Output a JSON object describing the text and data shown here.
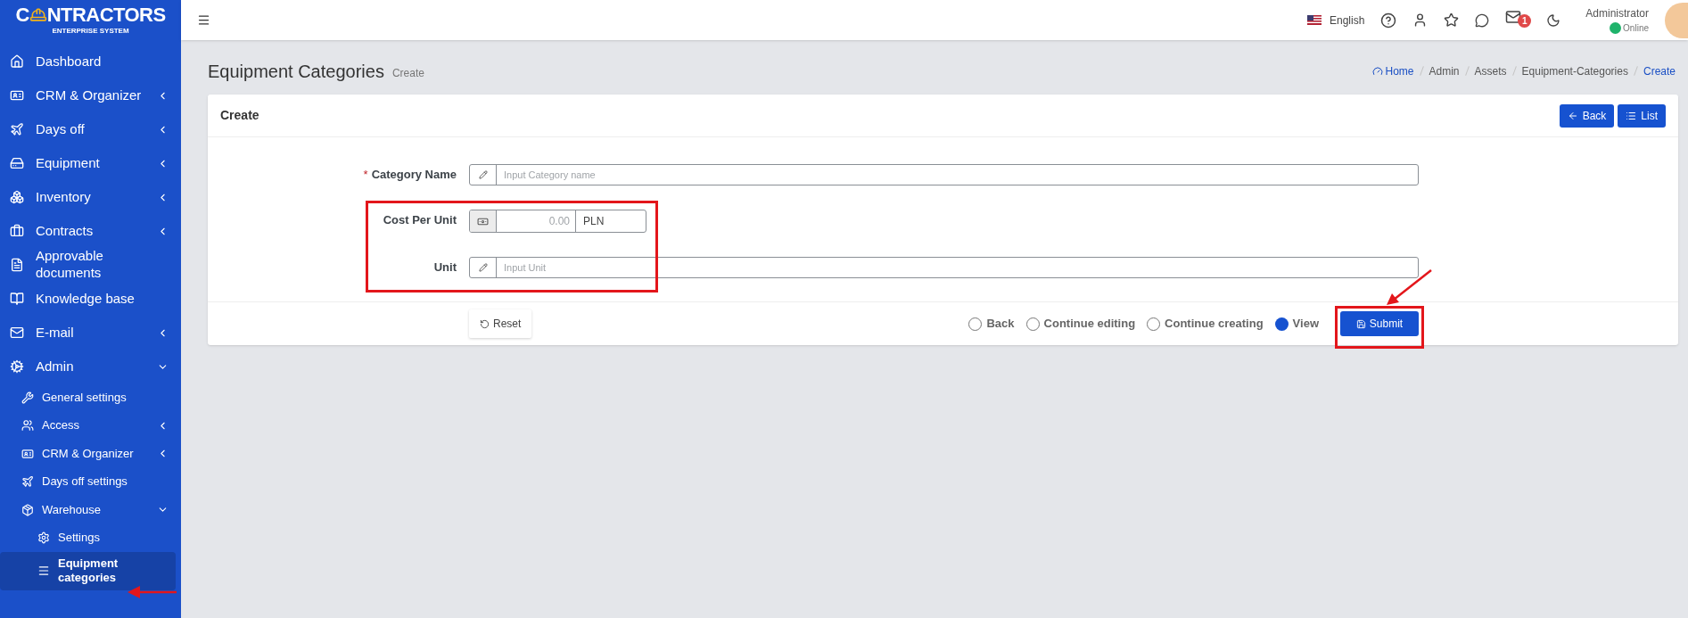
{
  "logo": {
    "text_before": "C",
    "text_after": "NTRACTORS",
    "subtitle": "ENTERPRISE SYSTEM"
  },
  "sidebar": {
    "items": [
      {
        "label": "Dashboard",
        "selected": false
      },
      {
        "label": "CRM & Organizer",
        "selected": false,
        "expanded": false
      },
      {
        "label": "Days off",
        "selected": false,
        "expanded": false
      },
      {
        "label": "Equipment",
        "selected": false,
        "expanded": false
      },
      {
        "label": "Inventory",
        "selected": false,
        "expanded": false
      },
      {
        "label": "Contracts",
        "selected": false,
        "expanded": false
      },
      {
        "label": "Approvable documents",
        "selected": false
      },
      {
        "label": "Knowledge base",
        "selected": false
      },
      {
        "label": "E-mail",
        "selected": false,
        "expanded": false
      },
      {
        "label": "Admin",
        "selected": false,
        "expanded": true,
        "children": [
          {
            "label": "General settings",
            "selected": false
          },
          {
            "label": "Access",
            "selected": false,
            "expanded": false
          },
          {
            "label": "CRM & Organizer",
            "selected": false,
            "expanded": false
          },
          {
            "label": "Days off settings",
            "selected": false
          },
          {
            "label": "Warehouse",
            "selected": false,
            "expanded": true,
            "children": [
              {
                "label": "Settings",
                "selected": false
              },
              {
                "label": "Equipment categories",
                "selected": true
              }
            ]
          }
        ]
      }
    ]
  },
  "topbar": {
    "language": "English",
    "mail_badge": "1",
    "user": {
      "name": "Administrator",
      "status": "Online",
      "online": true
    }
  },
  "page": {
    "title": "Equipment Categories",
    "subtitle": "Create"
  },
  "breadcrumb": [
    {
      "label": "Home",
      "link": true
    },
    {
      "label": "Admin",
      "link": false
    },
    {
      "label": "Assets",
      "link": false
    },
    {
      "label": "Equipment-Categories",
      "link": false
    },
    {
      "label": "Create",
      "link": true
    }
  ],
  "card": {
    "title": "Create",
    "buttons": [
      {
        "label": "Back",
        "kind": "back"
      },
      {
        "label": "List",
        "kind": "list"
      }
    ]
  },
  "form": {
    "fields": [
      {
        "kind": "text",
        "label": "Category Name",
        "required_mark": "*",
        "placeholder": "Input Category name"
      },
      {
        "kind": "money",
        "label": "Cost Per Unit",
        "placeholder": "0.00",
        "suffix": "PLN"
      },
      {
        "kind": "text",
        "label": "Unit",
        "placeholder": "Input Unit"
      }
    ],
    "reset": "Reset",
    "after_save": [
      {
        "label": "Back",
        "selected": false
      },
      {
        "label": "Continue editing",
        "selected": false
      },
      {
        "label": "Continue creating",
        "selected": false
      },
      {
        "label": "View",
        "selected": true
      }
    ],
    "submit": "Submit"
  }
}
